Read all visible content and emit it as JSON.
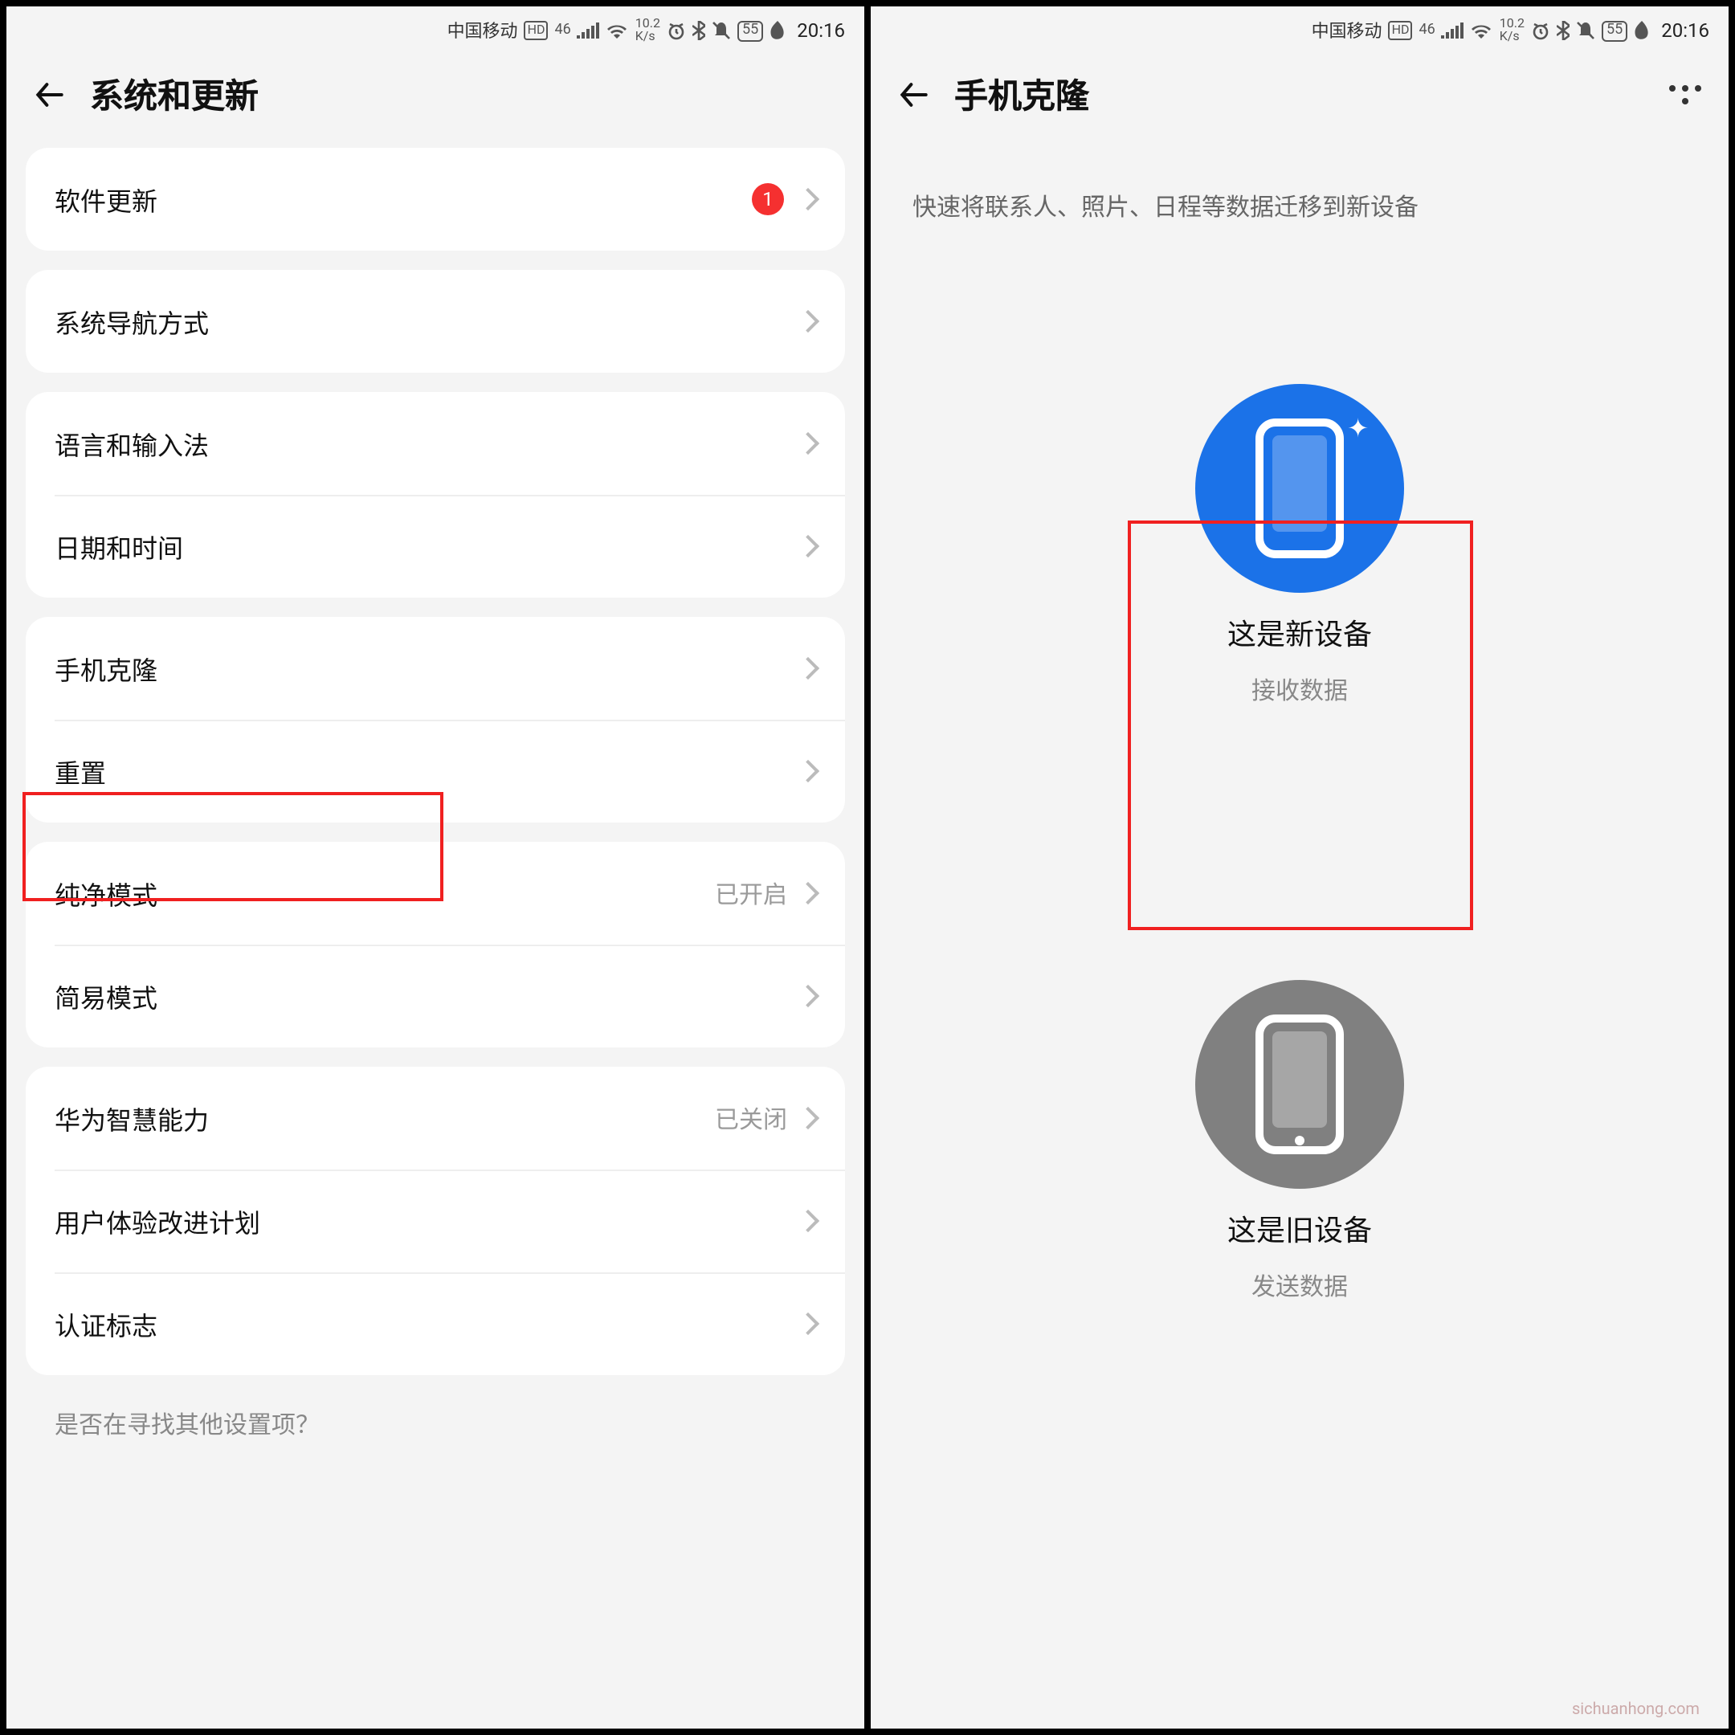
{
  "statusbar": {
    "carrier": "中国移动",
    "hd": "HD",
    "net": "46",
    "speed_top": "10.2",
    "speed_bot": "K/s",
    "batt": "55",
    "time": "20:16"
  },
  "left": {
    "title": "系统和更新",
    "groups": [
      {
        "rows": [
          {
            "title": "软件更新",
            "badge": "1"
          }
        ]
      },
      {
        "rows": [
          {
            "title": "系统导航方式"
          }
        ]
      },
      {
        "rows": [
          {
            "title": "语言和输入法"
          },
          {
            "title": "日期和时间"
          }
        ]
      },
      {
        "rows": [
          {
            "title": "手机克隆"
          },
          {
            "title": "重置"
          }
        ]
      },
      {
        "rows": [
          {
            "title": "纯净模式",
            "value": "已开启"
          },
          {
            "title": "简易模式"
          }
        ]
      },
      {
        "rows": [
          {
            "title": "华为智慧能力",
            "value": "已关闭"
          },
          {
            "title": "用户体验改进计划"
          },
          {
            "title": "认证标志"
          }
        ]
      }
    ],
    "footer_hint": "是否在寻找其他设置项？"
  },
  "right": {
    "title": "手机克隆",
    "subtitle": "快速将联系人、照片、日程等数据迁移到新设备",
    "new_device_title": "这是新设备",
    "new_device_sub": "接收数据",
    "old_device_title": "这是旧设备",
    "old_device_sub": "发送数据"
  },
  "watermark": "sichuanhong.com"
}
